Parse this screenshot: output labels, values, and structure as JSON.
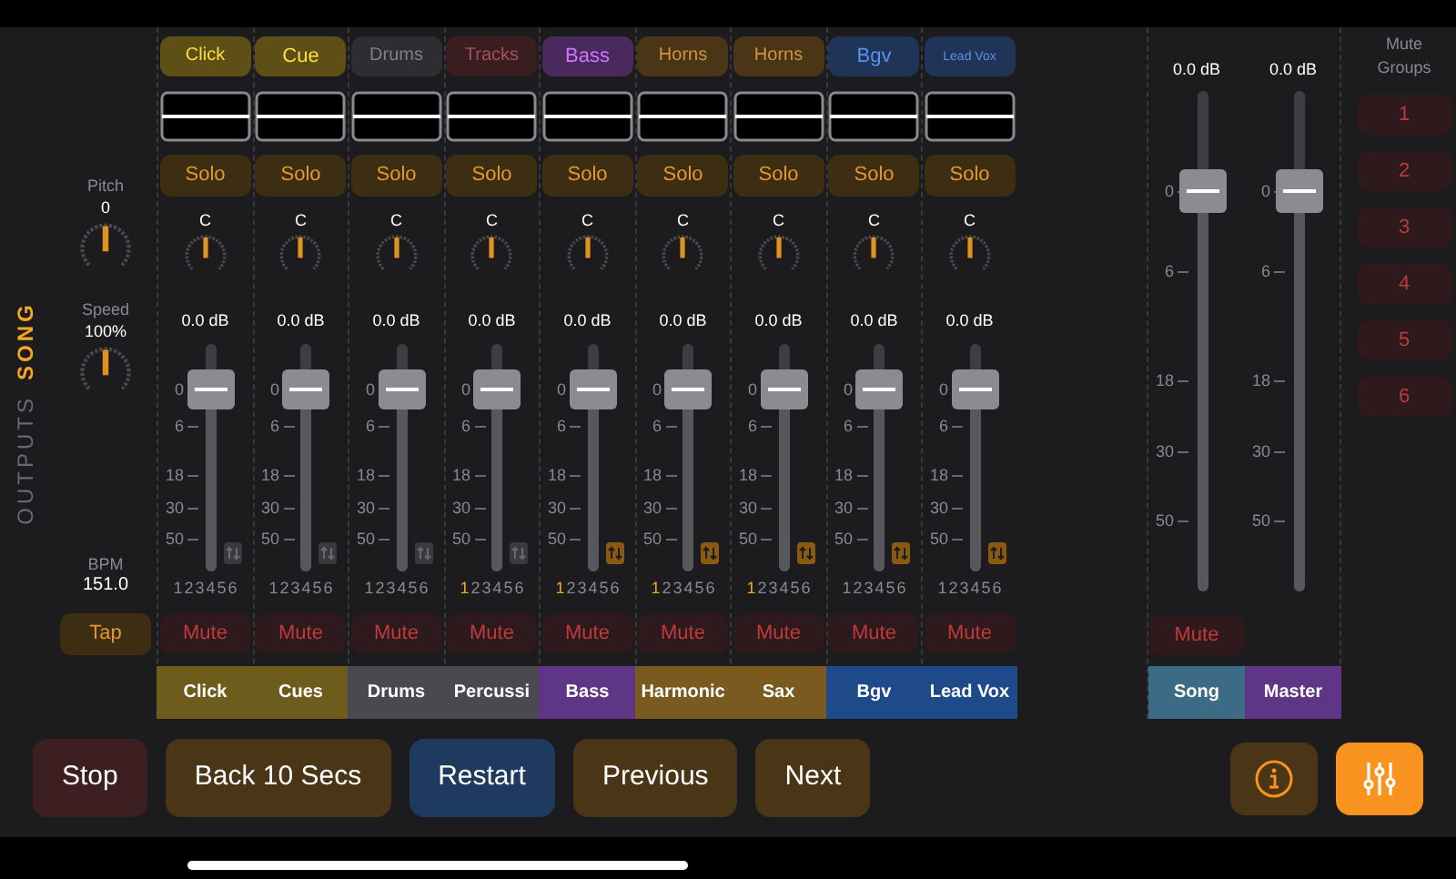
{
  "side_tabs": [
    {
      "label": "OUTPUTS",
      "selected": false
    },
    {
      "label": "SONG",
      "selected": true
    }
  ],
  "song_controls": {
    "pitch_label": "Pitch",
    "pitch_value": "0",
    "speed_label": "Speed",
    "speed_value": "100%",
    "bpm_label": "BPM",
    "bpm_value": "151.0",
    "tap": "Tap"
  },
  "channels": [
    {
      "label": {
        "text": "Click",
        "color": "#5e4f17"
      },
      "solo": "Solo",
      "pan": "C",
      "db": "0.0 dB",
      "level": 0.8,
      "scale": [
        "0",
        "6",
        "18",
        "30",
        "50"
      ],
      "routed": false,
      "groups": [
        {
          "label": "1",
          "selected": false
        },
        {
          "label": "2",
          "selected": false
        },
        {
          "label": "3",
          "selected": false
        },
        {
          "label": "4",
          "selected": false
        },
        {
          "label": "5",
          "selected": false
        },
        {
          "label": "6",
          "selected": false
        }
      ],
      "mute": "Mute",
      "name": {
        "text": "Click",
        "color": "#6d5c1b"
      }
    },
    {
      "label": {
        "text": "Cue",
        "color": "#5e4f17"
      },
      "solo": "Solo",
      "pan": "C",
      "db": "0.0 dB",
      "level": 0.8,
      "scale": [
        "0",
        "6",
        "18",
        "30",
        "50"
      ],
      "routed": false,
      "groups": [
        {
          "label": "1",
          "selected": false
        },
        {
          "label": "2",
          "selected": false
        },
        {
          "label": "3",
          "selected": false
        },
        {
          "label": "4",
          "selected": false
        },
        {
          "label": "5",
          "selected": false
        },
        {
          "label": "6",
          "selected": false
        }
      ],
      "mute": "Mute",
      "name": {
        "text": "Cues",
        "color": "#6d5c1b"
      }
    },
    {
      "label": {
        "text": "Drums",
        "color": "#2e2d31"
      },
      "solo": "Solo",
      "pan": "C",
      "db": "0.0 dB",
      "level": 0.8,
      "scale": [
        "0",
        "6",
        "18",
        "30",
        "50"
      ],
      "routed": false,
      "groups": [
        {
          "label": "1",
          "selected": false
        },
        {
          "label": "2",
          "selected": false
        },
        {
          "label": "3",
          "selected": false
        },
        {
          "label": "4",
          "selected": false
        },
        {
          "label": "5",
          "selected": false
        },
        {
          "label": "6",
          "selected": false
        }
      ],
      "mute": "Mute",
      "name": {
        "text": "Drums",
        "color": "#4a494f"
      }
    },
    {
      "label": {
        "text": "Tracks",
        "color": "#3a1d20"
      },
      "solo": "Solo",
      "pan": "C",
      "db": "0.0 dB",
      "level": 0.8,
      "scale": [
        "0",
        "6",
        "18",
        "30",
        "50"
      ],
      "routed": false,
      "groups": [
        {
          "label": "1",
          "selected": true
        },
        {
          "label": "2",
          "selected": false
        },
        {
          "label": "3",
          "selected": false
        },
        {
          "label": "4",
          "selected": false
        },
        {
          "label": "5",
          "selected": false
        },
        {
          "label": "6",
          "selected": false
        }
      ],
      "mute": "Mute",
      "name": {
        "text": "Percussi",
        "color": "#4a494f"
      }
    },
    {
      "label": {
        "text": "Bass",
        "color": "#4a2a5e"
      },
      "solo": "Solo",
      "pan": "C",
      "db": "0.0 dB",
      "level": 0.8,
      "scale": [
        "0",
        "6",
        "18",
        "30",
        "50"
      ],
      "routed": true,
      "groups": [
        {
          "label": "1",
          "selected": true
        },
        {
          "label": "2",
          "selected": false
        },
        {
          "label": "3",
          "selected": false
        },
        {
          "label": "4",
          "selected": false
        },
        {
          "label": "5",
          "selected": false
        },
        {
          "label": "6",
          "selected": false
        }
      ],
      "mute": "Mute",
      "name": {
        "text": "Bass",
        "color": "#5f3585"
      }
    },
    {
      "label": {
        "text": "Horns",
        "color": "#4a3516"
      },
      "solo": "Solo",
      "pan": "C",
      "db": "0.0 dB",
      "level": 0.8,
      "scale": [
        "0",
        "6",
        "18",
        "30",
        "50"
      ],
      "routed": true,
      "groups": [
        {
          "label": "1",
          "selected": true
        },
        {
          "label": "2",
          "selected": false
        },
        {
          "label": "3",
          "selected": false
        },
        {
          "label": "4",
          "selected": false
        },
        {
          "label": "5",
          "selected": false
        },
        {
          "label": "6",
          "selected": false
        }
      ],
      "mute": "Mute",
      "name": {
        "text": "Harmonic",
        "color": "#7a5a1e"
      }
    },
    {
      "label": {
        "text": "Horns",
        "color": "#4a3516"
      },
      "solo": "Solo",
      "pan": "C",
      "db": "0.0 dB",
      "level": 0.8,
      "scale": [
        "0",
        "6",
        "18",
        "30",
        "50"
      ],
      "routed": true,
      "groups": [
        {
          "label": "1",
          "selected": true
        },
        {
          "label": "2",
          "selected": false
        },
        {
          "label": "3",
          "selected": false
        },
        {
          "label": "4",
          "selected": false
        },
        {
          "label": "5",
          "selected": false
        },
        {
          "label": "6",
          "selected": false
        }
      ],
      "mute": "Mute",
      "name": {
        "text": "Sax",
        "color": "#7a5a1e"
      }
    },
    {
      "label": {
        "text": "Bgv",
        "color": "#1f3456"
      },
      "solo": "Solo",
      "pan": "C",
      "db": "0.0 dB",
      "level": 0.8,
      "scale": [
        "0",
        "6",
        "18",
        "30",
        "50"
      ],
      "routed": true,
      "groups": [
        {
          "label": "1",
          "selected": false
        },
        {
          "label": "2",
          "selected": false
        },
        {
          "label": "3",
          "selected": false
        },
        {
          "label": "4",
          "selected": false
        },
        {
          "label": "5",
          "selected": false
        },
        {
          "label": "6",
          "selected": false
        }
      ],
      "mute": "Mute",
      "name": {
        "text": "Bgv",
        "color": "#1e4a8a"
      }
    },
    {
      "label": {
        "text": "Lead Vox",
        "color": "#1f3456"
      },
      "solo": "Solo",
      "pan": "C",
      "db": "0.0 dB",
      "level": 0.8,
      "scale": [
        "0",
        "6",
        "18",
        "30",
        "50"
      ],
      "routed": true,
      "groups": [
        {
          "label": "1",
          "selected": false
        },
        {
          "label": "2",
          "selected": false
        },
        {
          "label": "3",
          "selected": false
        },
        {
          "label": "4",
          "selected": false
        },
        {
          "label": "5",
          "selected": false
        },
        {
          "label": "6",
          "selected": false
        }
      ],
      "mute": "Mute",
      "name": {
        "text": "Lead Vox",
        "color": "#1e4a8a"
      }
    }
  ],
  "outputs": [
    {
      "db": "0.0 dB",
      "level": 0.8,
      "scale": [
        "0",
        "6",
        "18",
        "30",
        "50"
      ],
      "mute": "Mute",
      "name": {
        "text": "Song",
        "color": "#3d6a85"
      }
    },
    {
      "db": "0.0 dB",
      "level": 0.8,
      "scale": [
        "0",
        "6",
        "18",
        "30",
        "50"
      ],
      "name": {
        "text": "Master",
        "color": "#5f3585"
      }
    }
  ],
  "mute_groups": {
    "title": "Mute Groups",
    "buttons": [
      "1",
      "2",
      "3",
      "4",
      "5",
      "6"
    ]
  },
  "transport": [
    {
      "label": "Stop",
      "color": "#3d1f22"
    },
    {
      "label": "Back 10 Secs",
      "color": "#4a3517"
    },
    {
      "label": "Restart",
      "color": "#1e3a5e"
    },
    {
      "label": "Previous",
      "color": "#4a3517"
    },
    {
      "label": "Next",
      "color": "#4a3517"
    }
  ],
  "tools": [
    {
      "kind": "info",
      "selected": false
    },
    {
      "kind": "mixer",
      "selected": true
    }
  ]
}
